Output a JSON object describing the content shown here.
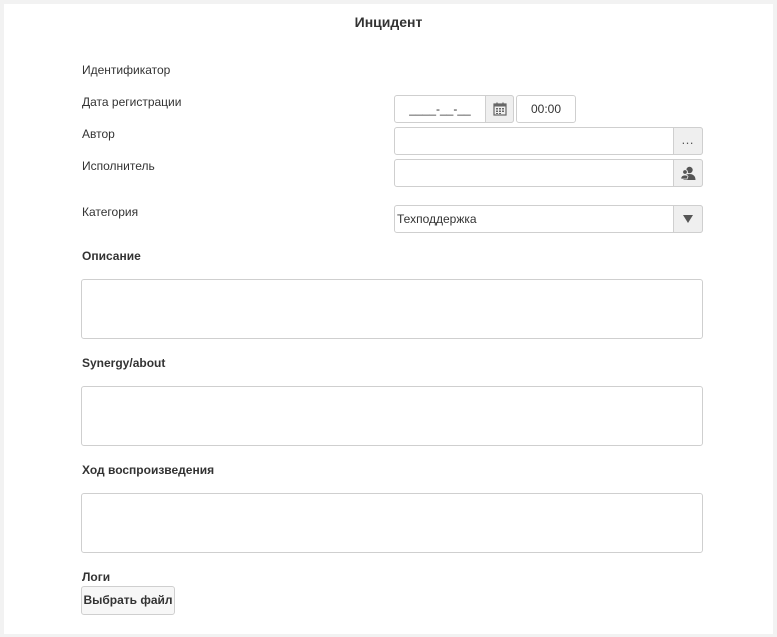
{
  "form": {
    "title": "Инцидент",
    "fields": {
      "identifier_label": "Идентификатор",
      "registration_date_label": "Дата регистрации",
      "registration_date_value": "____-__-__",
      "registration_time_value": "00:00",
      "author_label": "Автор",
      "author_value": "",
      "executor_label": "Исполнитель",
      "executor_value": "",
      "category_label": "Категория",
      "category_value": "Техподдержка"
    },
    "sections": {
      "description_label": "Описание",
      "synergy_label": "Synergy/about",
      "reproduction_label": "Ход воспроизведения",
      "logs_label": "Логи",
      "choose_file_button": "Выбрать файл"
    }
  },
  "icons": {
    "calendar": "calendar-icon",
    "ellipsis": "ellipsis-icon",
    "user": "user-icon",
    "dropdown": "chevron-down-icon"
  }
}
